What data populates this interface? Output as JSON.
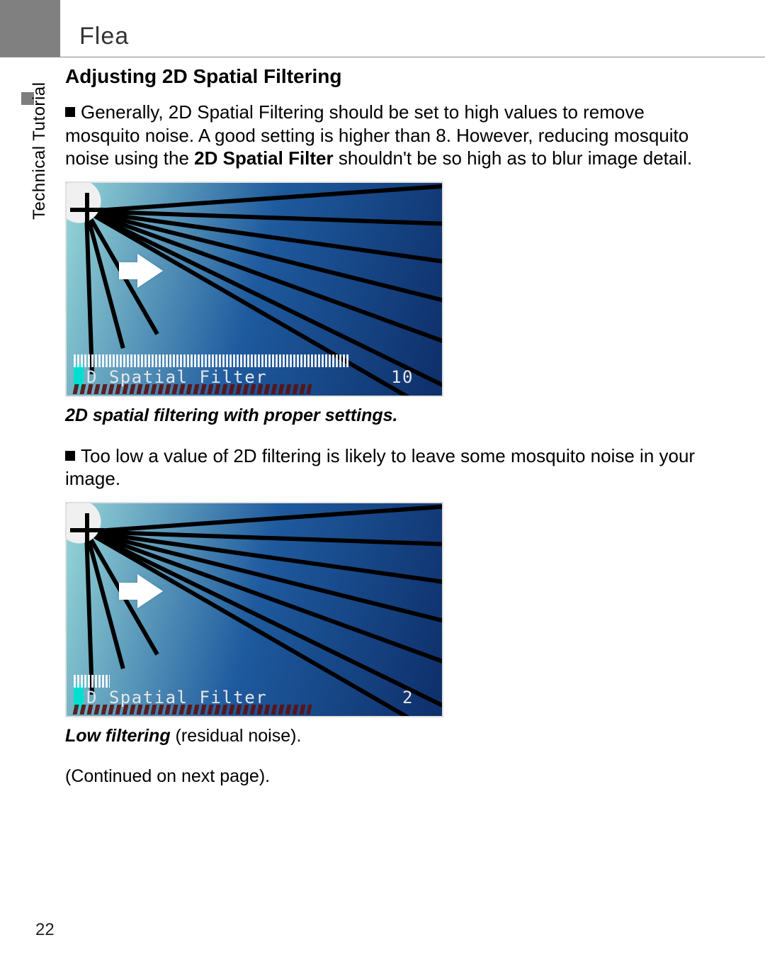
{
  "header": {
    "chapter_title": "Flea"
  },
  "sidebar": {
    "label": "Technical Tutorial"
  },
  "page_number": "22",
  "section": {
    "heading": "Adjusting 2D Spatial Filtering",
    "para1_leading": "Generally, 2D Spatial Filtering should be set to high values to remove mosquito noise. A good setting is higher than 8.  However, reducing mosquito noise using the ",
    "para1_strong": "2D Spatial Filter",
    "para1_trailing": " shouldn't be so high as to blur image detail.",
    "figure1": {
      "osd_label": "2D Spatial Filter",
      "osd_value": "10",
      "caption": "2D spatial filtering with proper settings."
    },
    "para2": "Too low a value of 2D filtering is likely to leave some mosquito noise in your image.",
    "figure2": {
      "osd_label": "2D Spatial Filter",
      "osd_value": "2",
      "caption_strong": "Low filtering",
      "caption_rest": " (residual noise)."
    },
    "continued": "(Continued on next page)."
  }
}
